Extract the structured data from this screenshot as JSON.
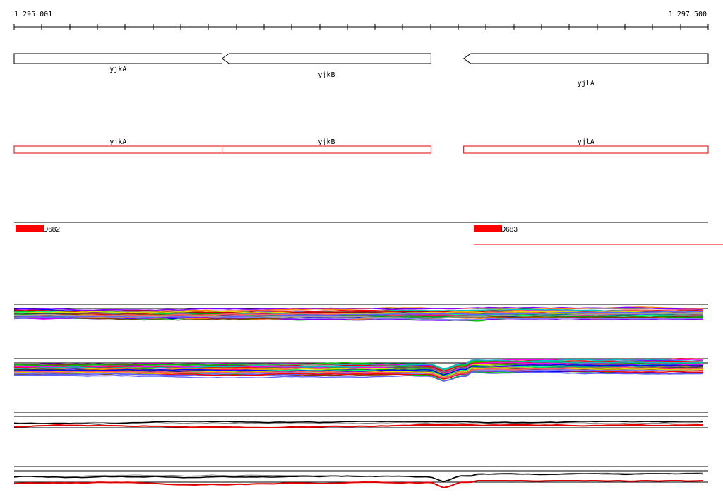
{
  "ruler": {
    "start_label": "1 295 001",
    "end_label": "1 297 500"
  },
  "genes": [
    {
      "name": "yjkA",
      "direction": "reverse",
      "start_frac": 0.0,
      "end_frac": 0.2996
    },
    {
      "name": "yjkB",
      "direction": "reverse",
      "start_frac": 0.2996,
      "end_frac": 0.6006
    },
    {
      "name": "yjlA",
      "direction": "reverse",
      "start_frac": 0.6477,
      "end_frac": 1.0
    }
  ],
  "features": [
    {
      "label": "D682"
    },
    {
      "label": "D683"
    }
  ],
  "colors": {
    "gene_outline": "#000000",
    "gene_box": "#e00000",
    "feature": "#ff0000",
    "track_lines": "#000000"
  },
  "tracks": [
    {
      "name": "expression-track-1",
      "type": "multi-color-profiles"
    },
    {
      "name": "expression-track-2",
      "type": "multi-color-profiles"
    },
    {
      "name": "expression-track-3",
      "type": "black-red-profiles"
    },
    {
      "name": "expression-track-4",
      "type": "black-red-profiles"
    }
  ]
}
